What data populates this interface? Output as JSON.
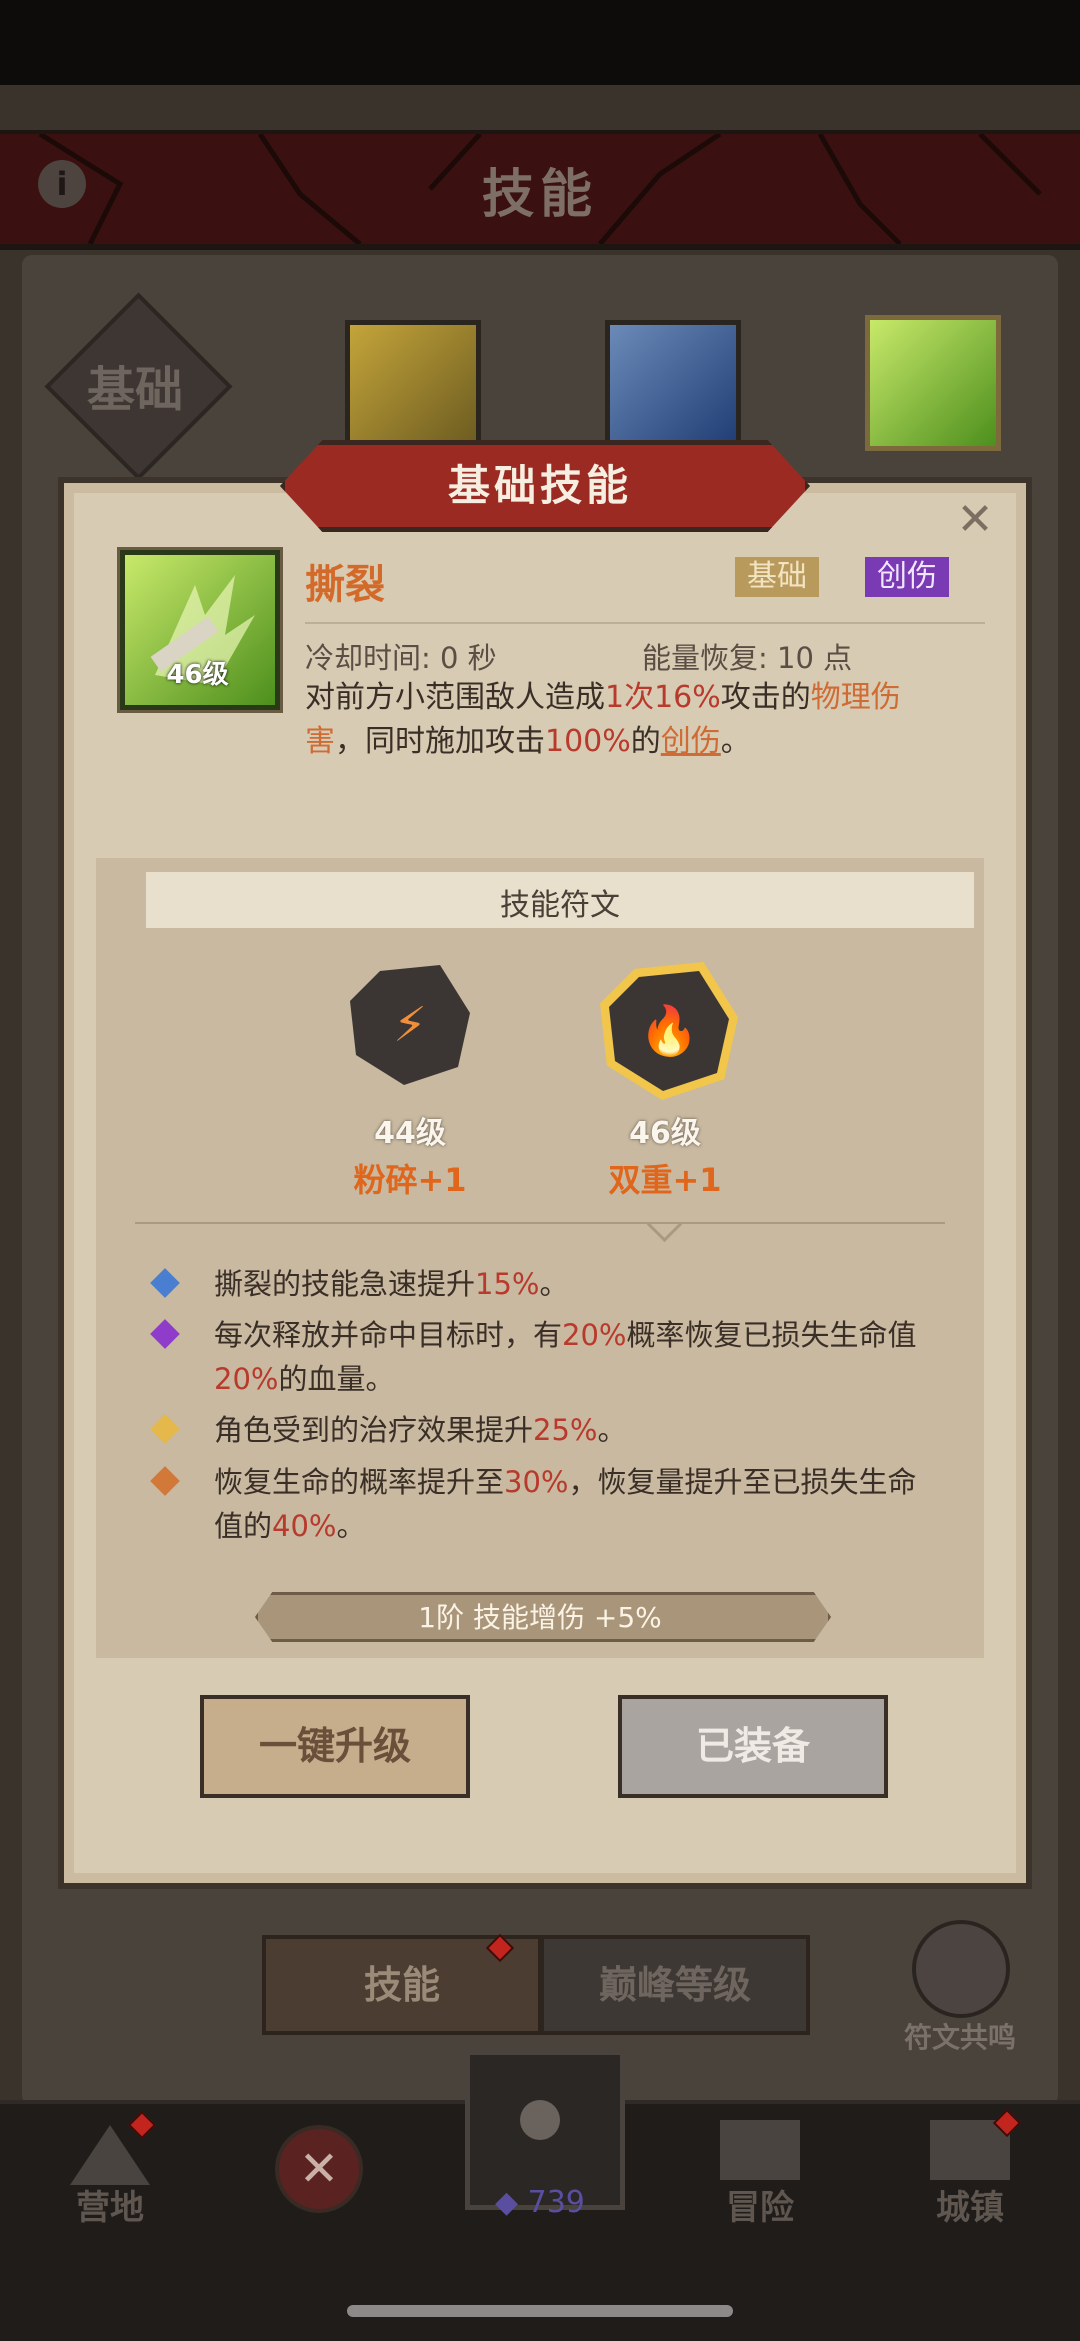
{
  "header": {
    "title": "技能",
    "info_icon": "info-icon"
  },
  "top_tabs": {
    "basic_label": "基础"
  },
  "modal": {
    "banner_title": "基础技能",
    "close_icon": "close-icon",
    "skill": {
      "name": "撕裂",
      "level": "46级",
      "tags": [
        "基础",
        "创伤"
      ],
      "cooldown": "冷却时间: 0 秒",
      "energy": "能量恢复: 10 点",
      "desc": {
        "p1": "对前方小范围敌人造成",
        "count": "1次",
        "pct": "16%",
        "p2": "攻击的",
        "phys": "物理伤害",
        "p3": "，同时施加攻击",
        "pct2": "100%",
        "p4": "的",
        "wound": "创伤",
        "p5": "。"
      }
    },
    "runes": {
      "title": "技能符文",
      "items": [
        {
          "level": "44级",
          "name": "粉碎+1"
        },
        {
          "level": "46级",
          "name": "双重+1"
        }
      ]
    },
    "bonuses": [
      {
        "color": "#4a7ed0",
        "a": "撕裂的技能急速提升",
        "v": "15%",
        "b": "。"
      },
      {
        "color": "#8e3cc9",
        "a": "每次释放并命中目标时，有",
        "v": "20%",
        "b": "概率恢复已损失生命值",
        "v2": "20%",
        "c": "的血量。"
      },
      {
        "color": "#e4b84a",
        "a": "角色受到的治疗效果提升",
        "v": "25%",
        "b": "。"
      },
      {
        "color": "#d2793a",
        "a": "恢复生命的概率提升至",
        "v": "30%",
        "b": "，恢复量提升至已损失生命值的",
        "v2": "40%",
        "c": "。"
      }
    ],
    "tier_bar": "1阶 技能增伤 +5%",
    "buttons": {
      "upgrade": "一键升级",
      "equipped": "已装备"
    }
  },
  "bottom_tabs": {
    "skill": "技能",
    "peak": "巅峰等级",
    "resonance": "符文共鸣"
  },
  "navbar": {
    "camp": "营地",
    "adventure": "冒险",
    "town": "城镇",
    "currency": "739"
  }
}
